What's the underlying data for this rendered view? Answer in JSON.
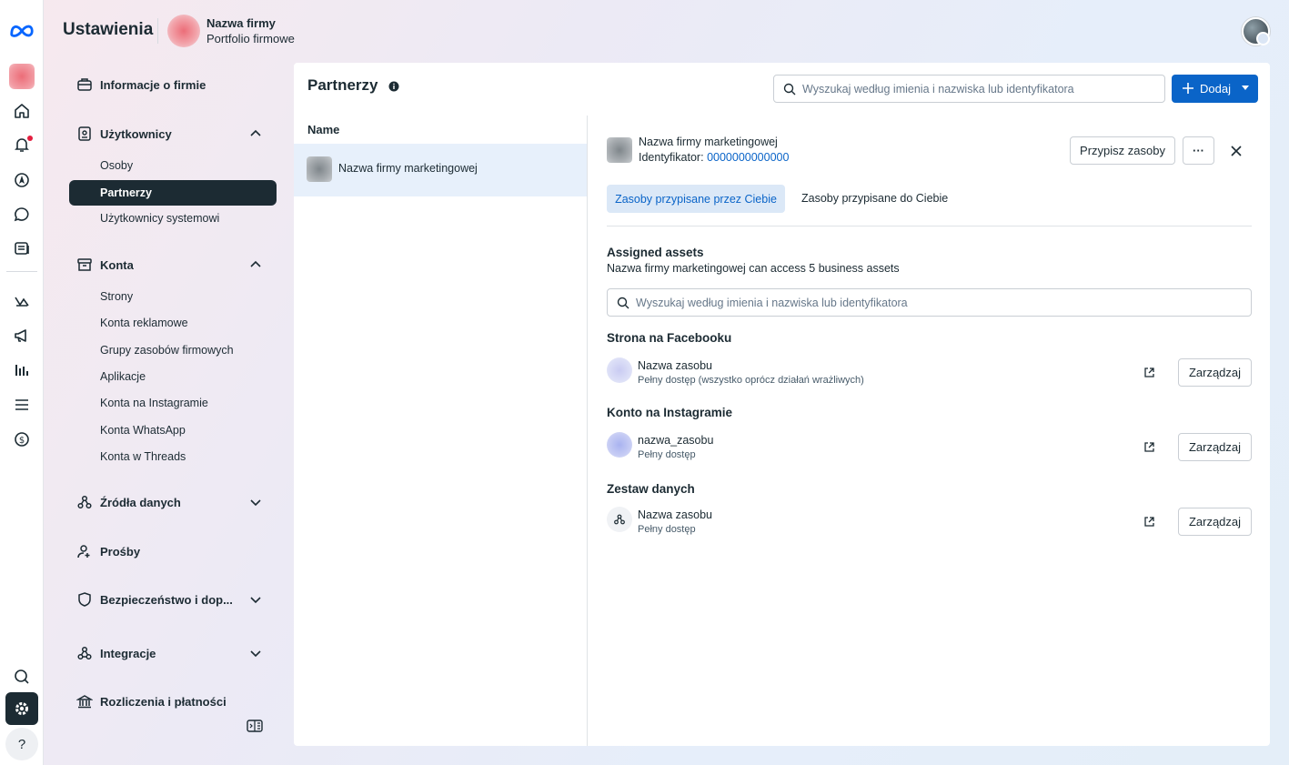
{
  "header": {
    "title": "Ustawienia",
    "business_name": "Nazwa firmy",
    "business_subtitle": "Portfolio firmowe"
  },
  "sidebar": {
    "items": [
      {
        "label": "Informacje o firmie",
        "icon": "briefcase-icon"
      },
      {
        "label": "Użytkownicy",
        "icon": "id-badge-icon",
        "expanded": true,
        "children": [
          "Osoby",
          "Partnerzy",
          "Użytkownicy systemowi"
        ],
        "active_child": "Partnerzy"
      },
      {
        "label": "Konta",
        "icon": "archive-icon",
        "expanded": true,
        "children": [
          "Strony",
          "Konta reklamowe",
          "Grupy zasobów firmowych",
          "Aplikacje",
          "Konta na Instagramie",
          "Konta WhatsApp",
          "Konta w Threads"
        ]
      },
      {
        "label": "Źródła danych",
        "icon": "data-sources-icon",
        "expanded": false
      },
      {
        "label": "Prośby",
        "icon": "person-add-icon"
      },
      {
        "label": "Bezpieczeństwo i dop...",
        "icon": "shield-icon",
        "expanded": false
      },
      {
        "label": "Integracje",
        "icon": "integrations-icon",
        "expanded": false
      },
      {
        "label": "Rozliczenia i płatności",
        "icon": "bank-icon"
      }
    ]
  },
  "main": {
    "title": "Partnerzy",
    "search_placeholder": "Wyszukaj według imienia i nazwiska lub identyfikatora",
    "add_label": "Dodaj",
    "list": {
      "column_header": "Name",
      "items": [
        {
          "name": "Nazwa firmy marketingowej",
          "selected": true
        }
      ]
    }
  },
  "detail": {
    "partner_name": "Nazwa firmy marketingowej",
    "id_label": "Identyfikator:",
    "id_value": "0000000000000",
    "assign_label": "Przypisz zasoby",
    "more_label": "···",
    "tabs": [
      "Zasoby przypisane przez Ciebie",
      "Zasoby przypisane do Ciebie"
    ],
    "assigned_title": "Assigned assets",
    "assigned_subtitle": "Nazwa firmy marketingowej can access 5 business assets",
    "search_placeholder": "Wyszukaj według imienia i nazwiska lub identyfikatora",
    "sections": [
      {
        "title": "Strona na Facebooku",
        "asset_name": "Nazwa zasobu",
        "access": "Pełny dostęp (wszystko oprócz działań wrażliwych)",
        "manage": "Zarządzaj"
      },
      {
        "title": "Konto na Instagramie",
        "asset_name": "nazwa_zasobu",
        "access": "Pełny dostęp",
        "manage": "Zarządzaj"
      },
      {
        "title": "Zestaw danych",
        "asset_name": "Nazwa zasobu",
        "access": "Pełny dostęp",
        "manage": "Zarządzaj"
      }
    ]
  },
  "colors": {
    "accent": "#0a64c8",
    "dark": "#1c2b33",
    "selected_row": "#e7f0fb"
  }
}
